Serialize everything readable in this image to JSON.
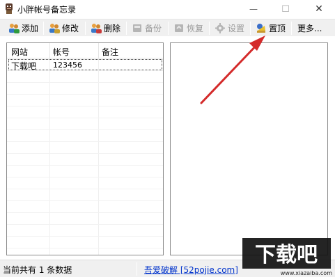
{
  "window": {
    "title": "小胖帐号备忘录",
    "min_glyph": "—",
    "max_glyph": "☐",
    "close_glyph": "✕"
  },
  "toolbar": {
    "add": "添加",
    "edit": "修改",
    "delete": "删除",
    "backup": "备份",
    "restore": "恢复",
    "settings": "设置",
    "pin_top": "置顶",
    "more": "更多..."
  },
  "table": {
    "columns": [
      "网站",
      "帐号",
      "备注"
    ],
    "rows": [
      {
        "site": "下载吧",
        "account": "123456",
        "note": ""
      }
    ]
  },
  "status": {
    "count_text": "当前共有 1 条数据",
    "link_text": "吾爱破解 [52pojie.com]"
  },
  "watermark": {
    "logo_text": "下载吧",
    "url": "www.xiazaiba.com"
  },
  "colors": {
    "arrow": "#d42a2a",
    "link": "#0033cc",
    "disabled": "#9a9a9a"
  }
}
